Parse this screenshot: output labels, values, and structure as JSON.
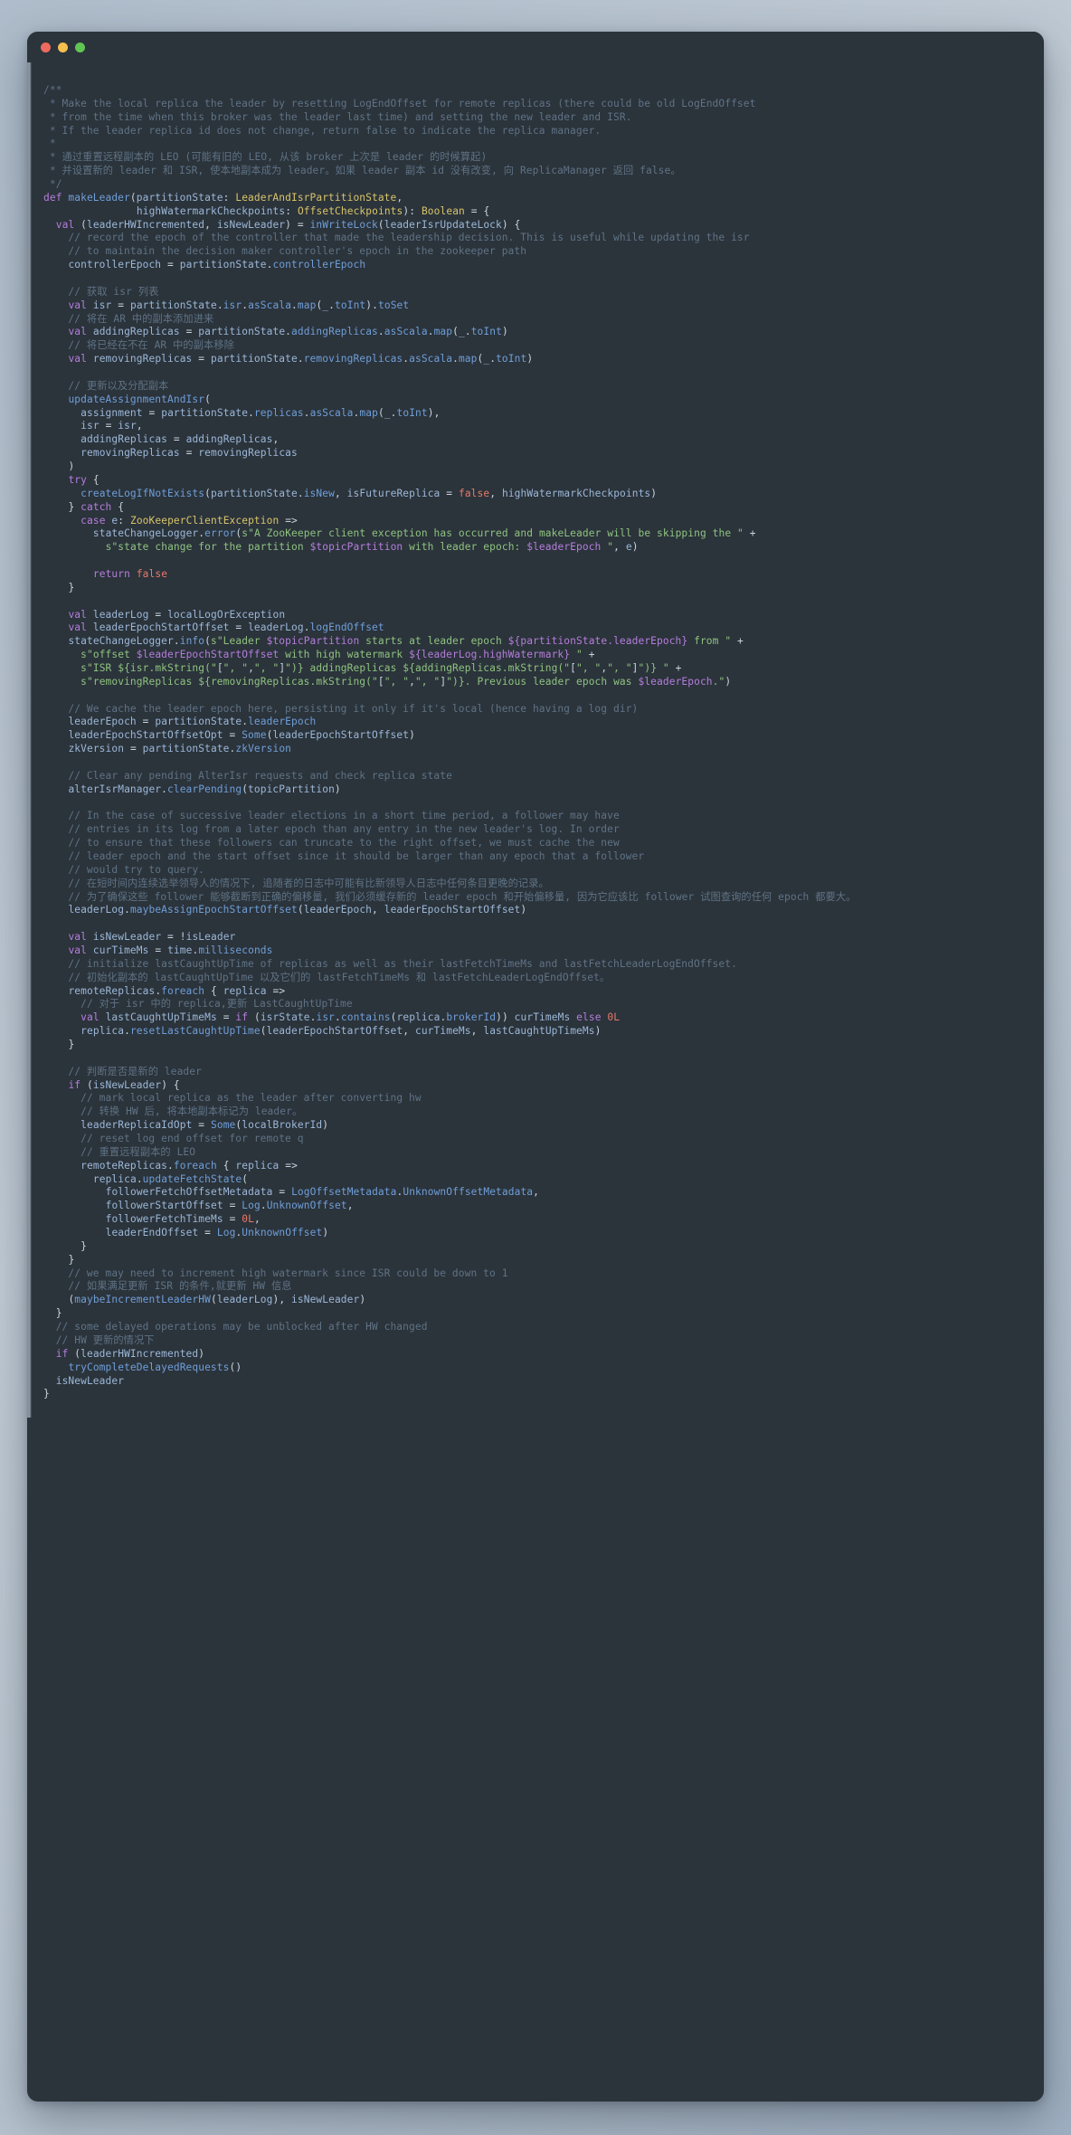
{
  "window": {
    "title": "",
    "traffic_lights": [
      {
        "name": "close-button",
        "color": "#ec6a5f"
      },
      {
        "name": "minimize-button",
        "color": "#f3bf4f"
      },
      {
        "name": "maximize-button",
        "color": "#61c554"
      }
    ],
    "background_color": "#2b333b"
  },
  "theme": {
    "background": "#2b333b",
    "comment": "#5f7385",
    "keyword": "#b57edc",
    "identifier": "#9cb8d8",
    "method": "#6f9fd8",
    "type": "#d8c56a",
    "string": "#8fc47f",
    "number": "#e8796a",
    "interpolation": "#b57edc",
    "plain": "#cdd8e2"
  },
  "editor": {
    "language": "Scala",
    "function_name": "makeLeader",
    "code_lines": [
      "/**",
      " * Make the local replica the leader by resetting LogEndOffset for remote replicas (there could be old LogEndOffset",
      " * from the time when this broker was the leader last time) and setting the new leader and ISR.",
      " * If the leader replica id does not change, return false to indicate the replica manager.",
      " *",
      " * 通过重置远程副本的 LEO (可能有旧的 LEO, 从该 broker 上次是 leader 的时候算起)",
      " * 并设置新的 leader 和 ISR, 使本地副本成为 leader。如果 leader 副本 id 没有改变, 向 ReplicaManager 返回 false。",
      " */",
      "def makeLeader(partitionState: LeaderAndIsrPartitionState,",
      "               highWatermarkCheckpoints: OffsetCheckpoints): Boolean = {",
      "  val (leaderHWIncremented, isNewLeader) = inWriteLock(leaderIsrUpdateLock) {",
      "    // record the epoch of the controller that made the leadership decision. This is useful while updating the isr",
      "    // to maintain the decision maker controller's epoch in the zookeeper path",
      "    controllerEpoch = partitionState.controllerEpoch",
      "",
      "    // 获取 isr 列表",
      "    val isr = partitionState.isr.asScala.map(_.toInt).toSet",
      "    // 将在 AR 中的副本添加进来",
      "    val addingReplicas = partitionState.addingReplicas.asScala.map(_.toInt)",
      "    // 将已经在不在 AR 中的副本移除",
      "    val removingReplicas = partitionState.removingReplicas.asScala.map(_.toInt)",
      "",
      "    // 更新以及分配副本",
      "    updateAssignmentAndIsr(",
      "      assignment = partitionState.replicas.asScala.map(_.toInt),",
      "      isr = isr,",
      "      addingReplicas = addingReplicas,",
      "      removingReplicas = removingReplicas",
      "    )",
      "    try {",
      "      createLogIfNotExists(partitionState.isNew, isFutureReplica = false, highWatermarkCheckpoints)",
      "    } catch {",
      "      case e: ZooKeeperClientException =>",
      "        stateChangeLogger.error(s\"A ZooKeeper client exception has occurred and makeLeader will be skipping the \" +",
      "          s\"state change for the partition $topicPartition with leader epoch: $leaderEpoch \", e)",
      "",
      "        return false",
      "    }",
      "",
      "    val leaderLog = localLogOrException",
      "    val leaderEpochStartOffset = leaderLog.logEndOffset",
      "    stateChangeLogger.info(s\"Leader $topicPartition starts at leader epoch ${partitionState.leaderEpoch} from \" +",
      "      s\"offset $leaderEpochStartOffset with high watermark ${leaderLog.highWatermark} \" +",
      "      s\"ISR ${isr.mkString(\"[\", \",\", \"]\")} addingReplicas ${addingReplicas.mkString(\"[\", \",\", \"]\")} \" +",
      "      s\"removingReplicas ${removingReplicas.mkString(\"[\", \",\", \"]\")}. Previous leader epoch was $leaderEpoch.\")",
      "",
      "    // We cache the leader epoch here, persisting it only if it's local (hence having a log dir)",
      "    leaderEpoch = partitionState.leaderEpoch",
      "    leaderEpochStartOffsetOpt = Some(leaderEpochStartOffset)",
      "    zkVersion = partitionState.zkVersion",
      "",
      "    // Clear any pending AlterIsr requests and check replica state",
      "    alterIsrManager.clearPending(topicPartition)",
      "",
      "    // In the case of successive leader elections in a short time period, a follower may have",
      "    // entries in its log from a later epoch than any entry in the new leader's log. In order",
      "    // to ensure that these followers can truncate to the right offset, we must cache the new",
      "    // leader epoch and the start offset since it should be larger than any epoch that a follower",
      "    // would try to query.",
      "    // 在短时间内连续选举领导人的情况下, 追随者的日志中可能有比新领导人日志中任何条目更晚的记录。",
      "    // 为了确保这些 follower 能够截断到正确的偏移量, 我们必须缓存新的 leader epoch 和开始偏移量, 因为它应该比 follower 试图查询的任何 epoch 都要大。",
      "    leaderLog.maybeAssignEpochStartOffset(leaderEpoch, leaderEpochStartOffset)",
      "",
      "    val isNewLeader = !isLeader",
      "    val curTimeMs = time.milliseconds",
      "    // initialize lastCaughtUpTime of replicas as well as their lastFetchTimeMs and lastFetchLeaderLogEndOffset.",
      "    // 初始化副本的 lastCaughtUpTime 以及它们的 lastFetchTimeMs 和 lastFetchLeaderLogEndOffset。",
      "    remoteReplicas.foreach { replica =>",
      "      // 对于 isr 中的 replica,更新 LastCaughtUpTime",
      "      val lastCaughtUpTimeMs = if (isrState.isr.contains(replica.brokerId)) curTimeMs else 0L",
      "      replica.resetLastCaughtUpTime(leaderEpochStartOffset, curTimeMs, lastCaughtUpTimeMs)",
      "    }",
      "",
      "    // 判断是否是新的 leader",
      "    if (isNewLeader) {",
      "      // mark local replica as the leader after converting hw",
      "      // 转换 HW 后, 将本地副本标记为 leader。",
      "      leaderReplicaIdOpt = Some(localBrokerId)",
      "      // reset log end offset for remote q",
      "      // 重置远程副本的 LEO",
      "      remoteReplicas.foreach { replica =>",
      "        replica.updateFetchState(",
      "          followerFetchOffsetMetadata = LogOffsetMetadata.UnknownOffsetMetadata,",
      "          followerStartOffset = Log.UnknownOffset,",
      "          followerFetchTimeMs = 0L,",
      "          leaderEndOffset = Log.UnknownOffset)",
      "      }",
      "    }",
      "    // we may need to increment high watermark since ISR could be down to 1",
      "    // 如果满足更新 ISR 的条件,就更新 HW 信息",
      "    (maybeIncrementLeaderHW(leaderLog), isNewLeader)",
      "  }",
      "  // some delayed operations may be unblocked after HW changed",
      "  // HW 更新的情况下",
      "  if (leaderHWIncremented)",
      "    tryCompleteDelayedRequests()",
      "  isNewLeader",
      "}"
    ]
  }
}
